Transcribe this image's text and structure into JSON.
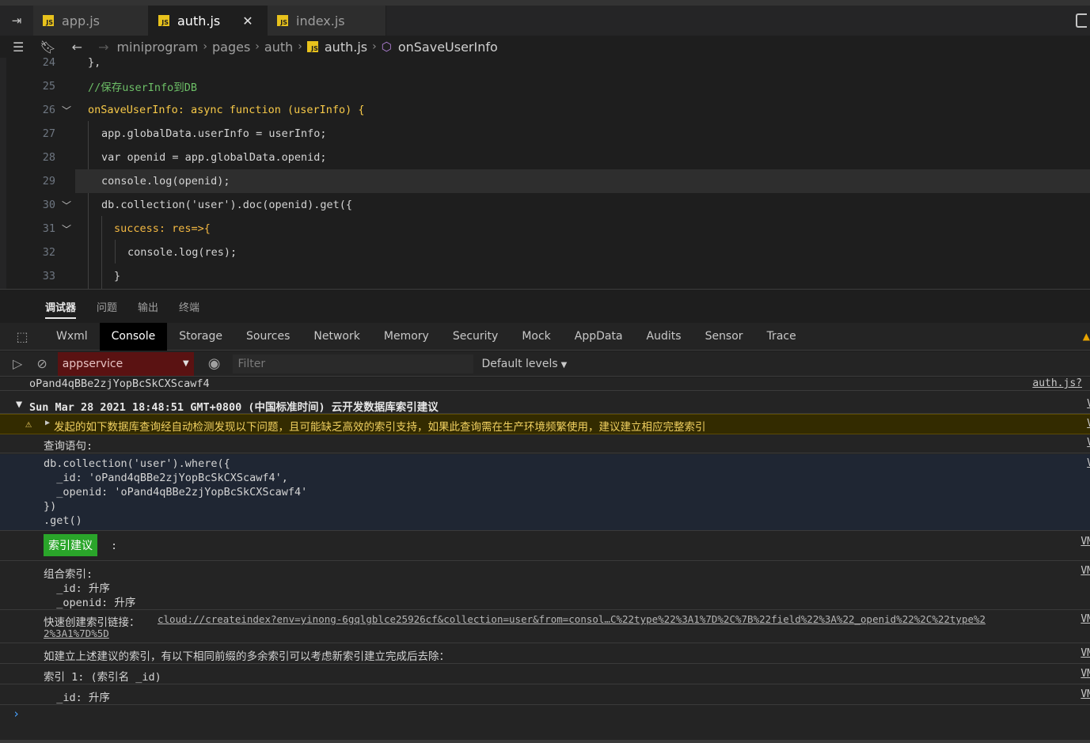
{
  "tabs": [
    {
      "label": "app.js",
      "active": false
    },
    {
      "label": "auth.js",
      "active": true
    },
    {
      "label": "index.js",
      "active": false
    }
  ],
  "breadcrumb": {
    "items": [
      "miniprogram",
      "pages",
      "auth",
      "auth.js",
      "onSaveUserInfo"
    ]
  },
  "editor": {
    "lines": [
      {
        "num": "24",
        "text": "},"
      },
      {
        "num": "25",
        "text": "//保存userInfo到DB"
      },
      {
        "num": "26",
        "text": "onSaveUserInfo: async function (userInfo) {"
      },
      {
        "num": "27",
        "text": "app.globalData.userInfo = userInfo;"
      },
      {
        "num": "28",
        "text": "var openid = app.globalData.openid;"
      },
      {
        "num": "29",
        "text": "console.log(openid);"
      },
      {
        "num": "30",
        "text": "db.collection('user').doc(openid).get({"
      },
      {
        "num": "31",
        "text": "success: res=>{"
      },
      {
        "num": "32",
        "text": "console.log(res);"
      },
      {
        "num": "33",
        "text": "}"
      }
    ]
  },
  "panel_tabs": [
    "调试器",
    "问题",
    "输出",
    "终端"
  ],
  "devtools_tabs": [
    "Wxml",
    "Console",
    "Storage",
    "Sources",
    "Network",
    "Memory",
    "Security",
    "Mock",
    "AppData",
    "Audits",
    "Sensor",
    "Trace"
  ],
  "console_toolbar": {
    "context": "appservice",
    "filter_placeholder": "Filter",
    "levels": "Default levels"
  },
  "console": {
    "openid_line": "oPand4qBBe2zjYopBcSkCXScawf4",
    "openid_src": "auth.js?",
    "group_header": "Sun Mar 28 2021 18:48:51 GMT+0800 (中国标准时间) 云开发数据库索引建议",
    "warning": "发起的如下数据库查询经自动检测发现以下问题，且可能缺乏高效的索引支持，如果此查询需在生产环境频繁使用，建议建立相应完整索引",
    "query_label": "查询语句:",
    "query_lines": [
      "db.collection('user').where({",
      "  _id: 'oPand4qBBe2zjYopBcSkCXScawf4',",
      "  _openid: 'oPand4qBBe2zjYopBcSkCXScawf4'",
      "})",
      ".get()"
    ],
    "index_badge": "索引建议",
    "index_badge_colon": ":",
    "composite_lines": [
      "组合索引:",
      "  _id: 升序",
      "  _openid: 升序"
    ],
    "quick_link_label": "快速创建索引链接：",
    "quick_link_1": "cloud://createindex?env=yinong-6gqlgblce25926cf&collection=user&from=consol…C%22type%22%3A1%7D%2C%7B%22field%22%3A%22_openid%22%2C%22type%2",
    "quick_link_2": "2%3A1%7D%5D",
    "redundant_note": "如建立上述建议的索引，有以下相同前缀的多余索引可以考虑新索引建立完成后去除：",
    "index1_line": "索引 1: (索引名 _id)",
    "index1_field": "  _id: 升序",
    "src_v": "V",
    "src_vm": "VM"
  },
  "colors": {
    "accent_green": "#2aa52a",
    "context_bg": "#5a1212",
    "warning_text": "#f0d060"
  }
}
